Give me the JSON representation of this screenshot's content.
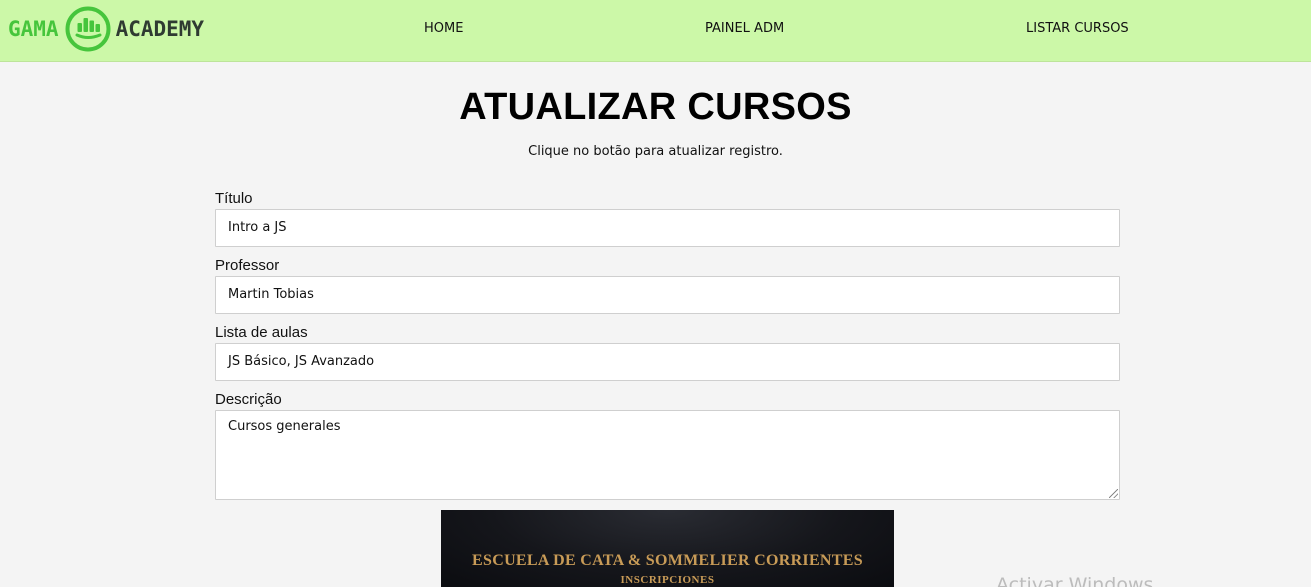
{
  "brand": {
    "left": "GAMA",
    "right": "ACADEMY",
    "accent_color": "#46c53c",
    "dark_color": "#2f3b32"
  },
  "nav": {
    "links": [
      "HOME",
      "PAINEL ADM",
      "LISTAR CURSOS"
    ],
    "background": "#ccf8a8"
  },
  "page": {
    "title": "ATUALIZAR CURSOS",
    "subtitle": "Clique no botão para atualizar registro."
  },
  "form": {
    "titulo": {
      "label": "Título",
      "value": "Intro a JS"
    },
    "professor": {
      "label": "Professor",
      "value": "Martin Tobias"
    },
    "aulas": {
      "label": "Lista de aulas",
      "value": "JS Básico, JS Avanzado"
    },
    "descricao": {
      "label": "Descrição",
      "value": "Cursos generales"
    }
  },
  "course_image": {
    "title": "ESCUELA DE CATA & SOMMELIER CORRIENTES",
    "subtitle": "INSCRIPCIONES",
    "text_color": "#c89b57"
  },
  "watermark": "Activar Windows"
}
